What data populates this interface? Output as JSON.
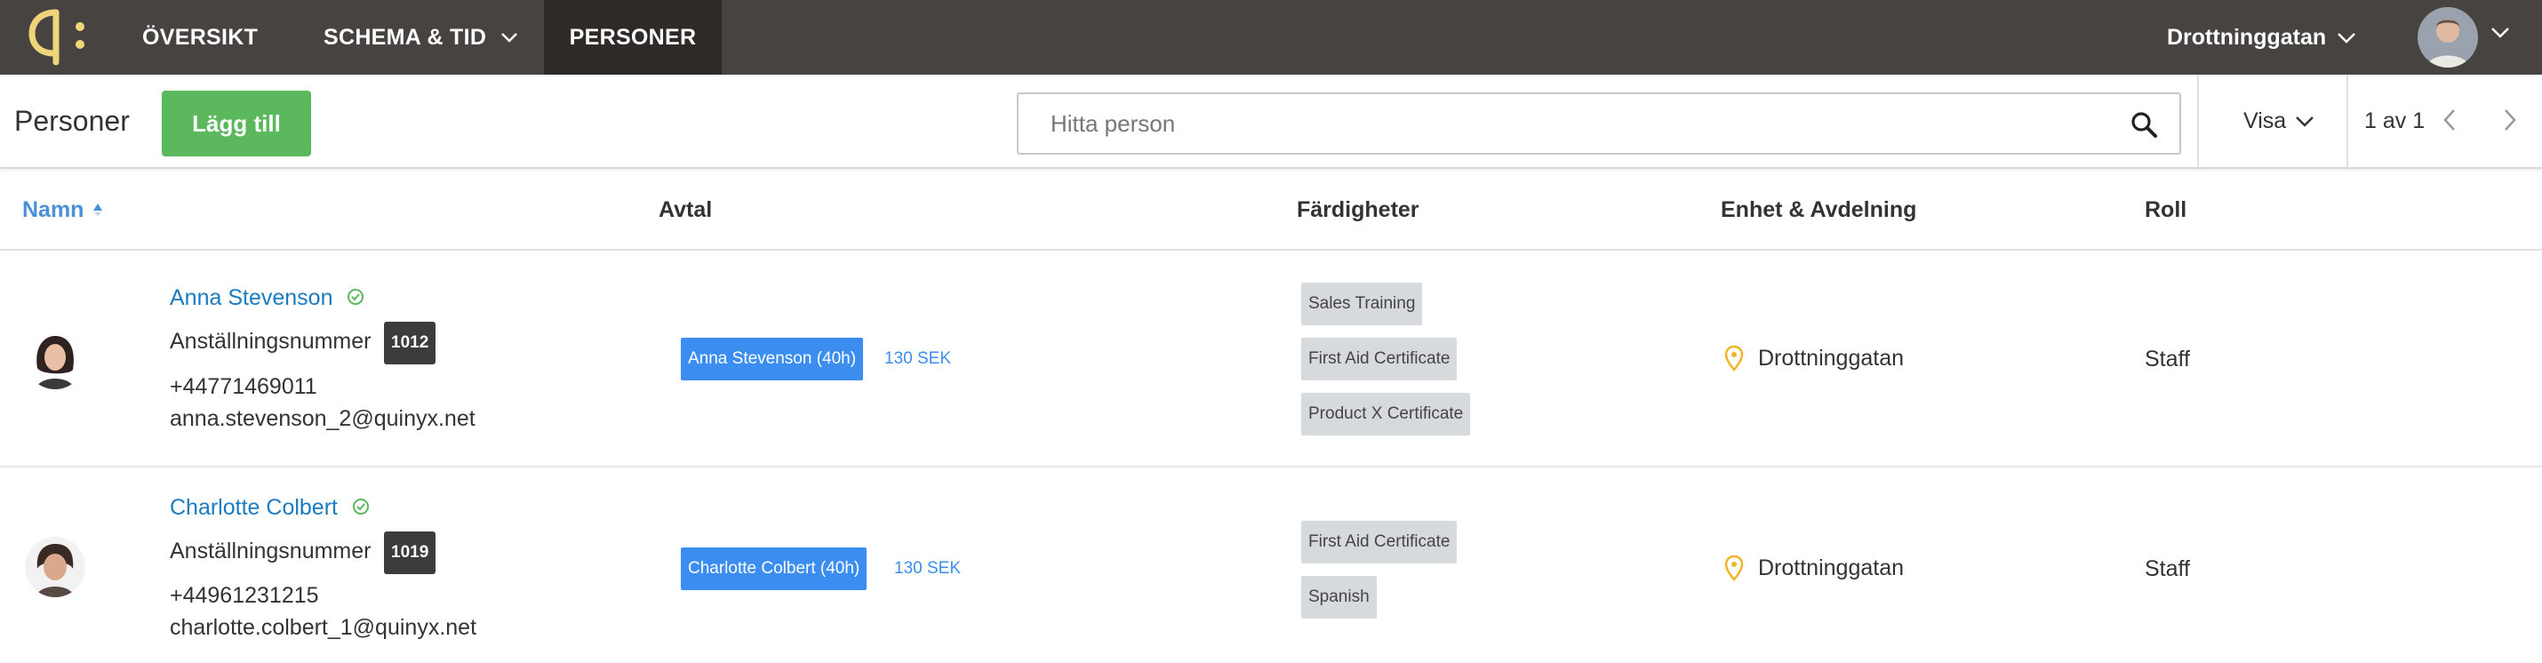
{
  "nav": {
    "items": [
      "ÖVERSIKT",
      "SCHEMA & TID",
      "PERSONER"
    ],
    "active": "PERSONER",
    "location": "Drottninggatan"
  },
  "toolbar": {
    "title": "Personer",
    "add_label": "Lägg till",
    "search_placeholder": "Hitta person",
    "view_label": "Visa",
    "page_info": "1 av 1"
  },
  "table": {
    "columns": [
      "Namn",
      "Avtal",
      "Färdigheter",
      "Enhet & Avdelning",
      "Roll"
    ],
    "sorted_by": "Namn",
    "rows": [
      {
        "name": "Anna Stevenson",
        "employee_label": "Anställningsnummer",
        "employee_number": "1012",
        "phone": "+44771469011",
        "email": "anna.stevenson_2@quinyx.net",
        "contract": "Anna Stevenson (40h)",
        "rate": "130 SEK",
        "skills": [
          "Sales Training",
          "First Aid Certificate",
          "Product X Certificate"
        ],
        "unit": "Drottninggatan",
        "role": "Staff"
      },
      {
        "name": "Charlotte Colbert",
        "employee_label": "Anställningsnummer",
        "employee_number": "1019",
        "phone": "+44961231215",
        "email": "charlotte.colbert_1@quinyx.net",
        "contract": "Charlotte Colbert (40h)",
        "rate": "130 SEK",
        "skills": [
          "First Aid Certificate",
          "Spanish"
        ],
        "unit": "Drottninggatan",
        "role": "Staff"
      }
    ]
  },
  "colors": {
    "topbar": "#474341",
    "active_tab": "#2d2a28",
    "logo": "#f0d47a",
    "primary_button": "#5cb85c",
    "link": "#1b7bc1",
    "contract": "#3b8ef0",
    "skill_tag": "#d7dadd",
    "location_pin": "#f0b429",
    "verified": "#5cb85c"
  }
}
